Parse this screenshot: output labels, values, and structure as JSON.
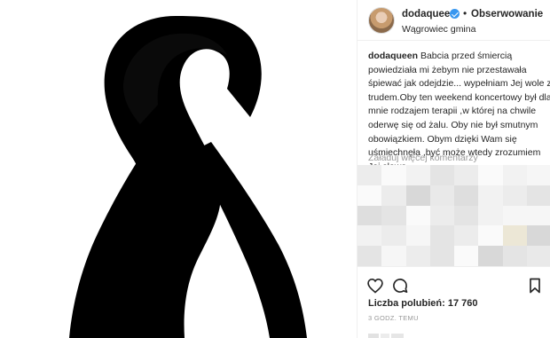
{
  "post": {
    "media": {
      "subject": "black mourning ribbon",
      "ribbon_color": "#000000",
      "background": "#ffffff"
    },
    "header": {
      "username": "dodaqueen",
      "verified": true,
      "separator": "•",
      "follow_label": "Obserwowanie",
      "location": "Wągrowiec gmina"
    },
    "caption": {
      "username": "dodaqueen",
      "lines": [
        "Babcia przed śmiercią",
        "powiedziała mi żebym nie przestawała",
        "śpiewać jak odejdzie... wypełniam Jej wole z",
        "trudem.Oby ten weekend koncertowy był dla",
        "mnie rodzajem terapii ,w której na chwile",
        "oderwę się od żalu. Oby nie był smutnym",
        "obowiązkiem. Obym dzięki Wam się",
        "uśmiechnęła ,być może wtedy zrozumiem",
        "Jej słowa..."
      ]
    },
    "load_more_comments": "Załaduj więcej komentarzy",
    "comments_obscured": true,
    "actions": {
      "like_icon": "heart-icon",
      "comment_icon": "comment-icon",
      "save_icon": "bookmark-icon"
    },
    "likes": "Liczba polubień: 17 760",
    "time_ago": "3 GODZ. TEMU"
  }
}
